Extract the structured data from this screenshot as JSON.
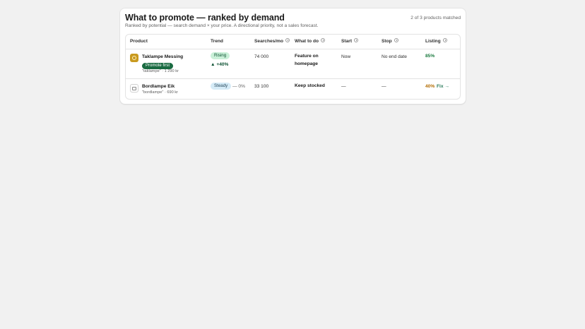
{
  "header": {
    "title": "What to promote — ranked by demand",
    "subtitle": "Ranked by potential — search demand × your price. A directional priority, not a sales forecast.",
    "match_count": "2 of 3 products matched"
  },
  "columns": {
    "product": "Product",
    "trend": "Trend",
    "searches": "Searches/mo",
    "action": "What to do",
    "start": "Start",
    "stop": "Stop",
    "listing": "Listing"
  },
  "rows": [
    {
      "icon": "lamp-icon",
      "name": "Taklampe Messing",
      "badge": "Promote first",
      "meta": "\"taklampe\" · 1 290 kr",
      "trend_label": "Rising",
      "trend_delta": "▲ +40%",
      "searches": "74 000",
      "action": "Feature on homepage",
      "start": "Now",
      "stop": "No end date",
      "listing": "85%",
      "fix": ""
    },
    {
      "icon": "image-placeholder-icon",
      "name": "Bordlampe Eik",
      "badge": "",
      "meta": "\"bordlampe\" · 690 kr",
      "trend_label": "Steady",
      "trend_delta": "— 0%",
      "searches": "33 100",
      "action": "Keep stocked",
      "start": "—",
      "stop": "—",
      "listing": "40%",
      "fix": "Fix →"
    }
  ],
  "colors": {
    "promote_badge": "#1a6b42",
    "rising_pill": "#c9f0d8",
    "steady_pill": "#d5ebf7",
    "listing_good": "#1a7a3e",
    "listing_warn": "#b26b00"
  }
}
